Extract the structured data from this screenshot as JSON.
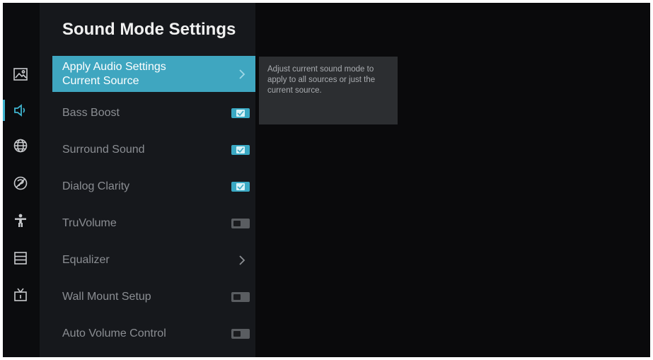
{
  "title": "Sound Mode Settings",
  "rail": {
    "icons": [
      "picture-icon",
      "sound-icon",
      "globe-icon",
      "accessibility-icon",
      "person-icon",
      "list-icon",
      "tv-icon"
    ],
    "active_index": 1,
    "accent": "#3fb4cf"
  },
  "menu": {
    "selected": {
      "line1": "Apply Audio Settings",
      "line2": "Current Source",
      "control": "chevron"
    },
    "items": [
      {
        "label": "Bass Boost",
        "control": "checkbox",
        "checked": true
      },
      {
        "label": "Surround Sound",
        "control": "checkbox",
        "checked": true
      },
      {
        "label": "Dialog Clarity",
        "control": "checkbox",
        "checked": true
      },
      {
        "label": "TruVolume",
        "control": "toggle",
        "checked": false
      },
      {
        "label": "Equalizer",
        "control": "chevron"
      },
      {
        "label": "Wall Mount Setup",
        "control": "toggle",
        "checked": false
      },
      {
        "label": "Auto Volume Control",
        "control": "toggle",
        "checked": false
      }
    ]
  },
  "tooltip": {
    "text": "Adjust current sound mode to apply to all sources or just the current source."
  },
  "colors": {
    "accent": "#3fa6c0",
    "panel": "#16181c",
    "background": "#0a0a0c"
  }
}
